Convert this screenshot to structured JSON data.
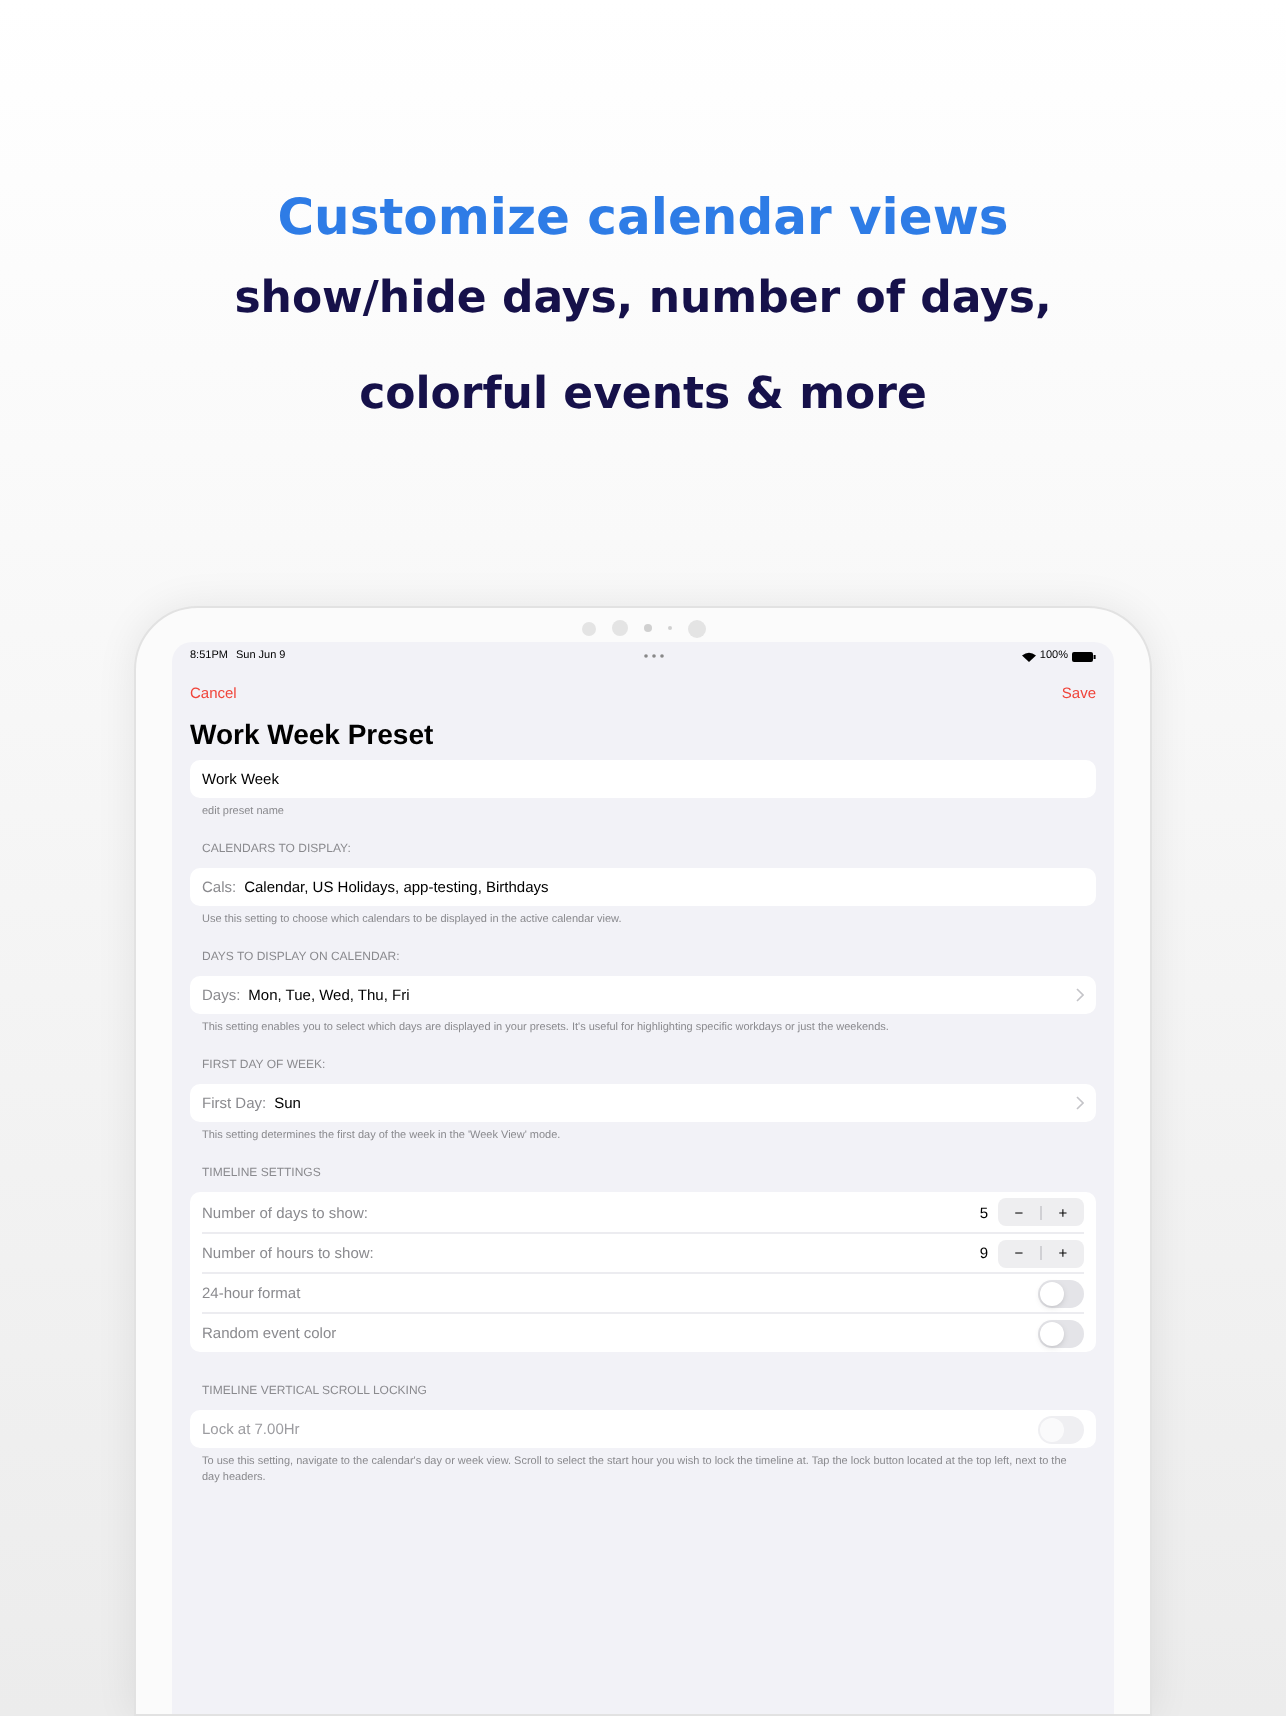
{
  "headline": {
    "title": "Customize calendar views",
    "lines": [
      "show/hide days, number of days,",
      "colorful events & more"
    ]
  },
  "status_bar": {
    "time": "8:51PM",
    "date": "Sun Jun 9",
    "battery": "100%"
  },
  "nav": {
    "cancel": "Cancel",
    "save": "Save",
    "title": "Work Week Preset"
  },
  "name_field": {
    "value": "Work Week",
    "footer": "edit preset name"
  },
  "sections": [
    {
      "header": "CALENDARS TO DISPLAY:",
      "label": "Cals:",
      "value": "Calendar, US Holidays, app-testing, Birthdays",
      "chevron": false,
      "footer": "Use this setting to choose which calendars to be displayed in the active calendar view."
    },
    {
      "header": "DAYS TO DISPLAY ON CALENDAR:",
      "label": "Days:",
      "value": "Mon, Tue, Wed, Thu, Fri",
      "chevron": true,
      "footer": "This setting enables you to select which days are displayed in your presets. It's useful for highlighting specific workdays or just the weekends."
    },
    {
      "header": "FIRST DAY OF WEEK:",
      "label": "First Day:",
      "value": "Sun",
      "chevron": true,
      "footer": "This setting determines the first day of the week in the 'Week View' mode."
    }
  ],
  "timeline": {
    "header": "TIMELINE SETTINGS",
    "rows": [
      {
        "kind": "stepper",
        "label": "Number of days to show:",
        "value": "5",
        "minus": "−",
        "plus": "+"
      },
      {
        "kind": "stepper",
        "label": "Number of hours to show:",
        "value": "9",
        "minus": "−",
        "plus": "+"
      },
      {
        "kind": "toggle",
        "label": "24-hour format",
        "on": false
      },
      {
        "kind": "toggle",
        "label": "Random event color",
        "on": false
      }
    ]
  },
  "scroll_lock": {
    "header": "TIMELINE VERTICAL SCROLL LOCKING",
    "label": "Lock at 7.00Hr",
    "on": false,
    "disabled": true,
    "footer": "To use this setting, navigate to the calendar's day or week view. Scroll to select the start hour you wish to lock the timeline at. Tap the lock button located at the top left, next to the day headers."
  }
}
